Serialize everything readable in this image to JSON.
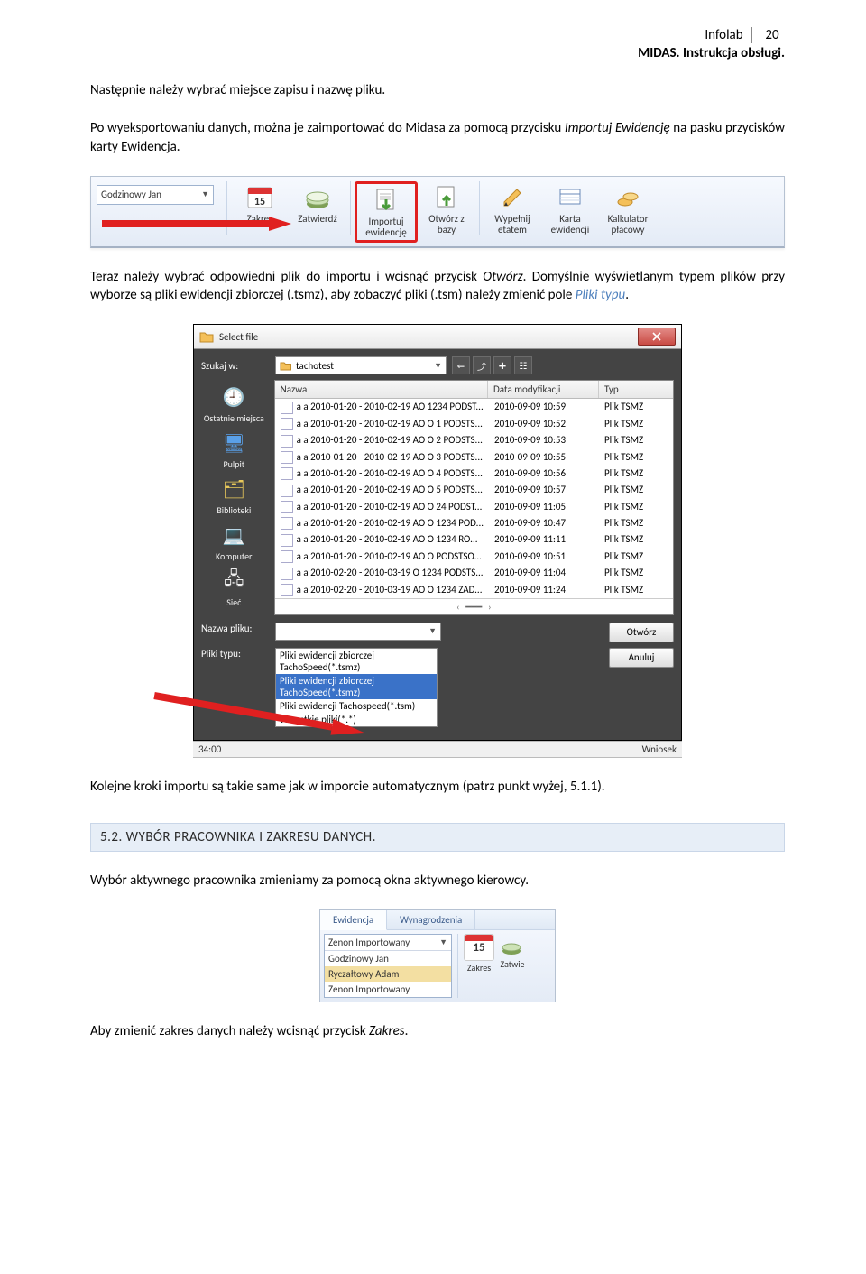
{
  "header": {
    "label": "Infolab",
    "page": "20",
    "doc_title": "MIDAS. Instrukcja obsługi."
  },
  "para1": "Następnie należy wybrać miejsce zapisu i nazwę pliku.",
  "para2_a": "Po wyeksportowaniu danych, można je zaimportować do Midasa za pomocą przycisku ",
  "para2_b": "Importuj Ewidencję",
  "para2_c": " na pasku przycisków karty Ewidencja.",
  "toolbar": {
    "driver": "Godzinowy Jan",
    "buttons": {
      "zakres": "Zakres",
      "zatwierdz": "Zatwierdź",
      "importuj_l1": "Importuj",
      "importuj_l2": "ewidencję",
      "otworz_l1": "Otwórz z",
      "otworz_l2": "bazy",
      "wypelnij_l1": "Wypełnij",
      "wypelnij_l2": "etatem",
      "karta_l1": "Karta",
      "karta_l2": "ewidencji",
      "kalk_l1": "Kalkulator",
      "kalk_l2": "płacowy"
    }
  },
  "para3_a": "Teraz należy wybrać odpowiedni plik do importu i wcisnąć przycisk ",
  "para3_b": "Otwórz",
  "para3_c": ". Domyślnie wyświetlanym typem plików przy wyborze są pliki ewidencji zbiorczej (.tsmz), aby zobaczyć pliki (.tsm) należy zmienić pole ",
  "para3_d": "Pliki typu",
  "para3_e": ".",
  "dialog": {
    "title": "Select file",
    "szukaj_label": "Szukaj w:",
    "szukaj_value": "tachotest",
    "cols": {
      "name": "Nazwa",
      "date": "Data modyfikacji",
      "type": "Typ"
    },
    "sidebar": {
      "recent": "Ostatnie miejsca",
      "desktop": "Pulpit",
      "libs": "Biblioteki",
      "computer": "Komputer",
      "network": "Sieć"
    },
    "rows": [
      {
        "n": "a a 2010-01-20 - 2010-02-19 AO 1234 PODST...",
        "d": "2010-09-09 10:59",
        "t": "Plik TSMZ"
      },
      {
        "n": "a a 2010-01-20 - 2010-02-19 AO O 1 PODSTS...",
        "d": "2010-09-09 10:52",
        "t": "Plik TSMZ"
      },
      {
        "n": "a a 2010-01-20 - 2010-02-19 AO O 2 PODSTS...",
        "d": "2010-09-09 10:53",
        "t": "Plik TSMZ"
      },
      {
        "n": "a a 2010-01-20 - 2010-02-19 AO O 3 PODSTS...",
        "d": "2010-09-09 10:55",
        "t": "Plik TSMZ"
      },
      {
        "n": "a a 2010-01-20 - 2010-02-19 AO O 4 PODSTS...",
        "d": "2010-09-09 10:56",
        "t": "Plik TSMZ"
      },
      {
        "n": "a a 2010-01-20 - 2010-02-19 AO O 5 PODSTS...",
        "d": "2010-09-09 10:57",
        "t": "Plik TSMZ"
      },
      {
        "n": "a a 2010-01-20 - 2010-02-19 AO O 24 PODST...",
        "d": "2010-09-09 11:05",
        "t": "Plik TSMZ"
      },
      {
        "n": "a a 2010-01-20 - 2010-02-19 AO O 1234 POD...",
        "d": "2010-09-09 10:47",
        "t": "Plik TSMZ"
      },
      {
        "n": "a a 2010-01-20 - 2010-02-19 AO O 1234 RO...",
        "d": "2010-09-09 11:11",
        "t": "Plik TSMZ"
      },
      {
        "n": "a a 2010-01-20 - 2010-02-19 AO O PODSTSO...",
        "d": "2010-09-09 10:51",
        "t": "Plik TSMZ"
      },
      {
        "n": "a a 2010-02-20 - 2010-03-19 O 1234 PODSTS...",
        "d": "2010-09-09 11:04",
        "t": "Plik TSMZ"
      },
      {
        "n": "a a 2010-02-20 - 2010-03-19 AO O 1234 ZAD...",
        "d": "2010-09-09 11:24",
        "t": "Plik TSMZ"
      }
    ],
    "filename_label": "Nazwa pliku:",
    "filename_value": "",
    "type_label": "Pliki typu:",
    "type_options": {
      "o1": "Pliki ewidencji zbiorczej TachoSpeed(*.tsmz)",
      "o2": "Pliki ewidencji zbiorczej TachoSpeed(*.tsmz)",
      "o3": "Pliki ewidencji Tachospeed(*.tsm)",
      "o4": "Wszystkie pliki(*.*)"
    },
    "open_btn": "Otwórz",
    "cancel_btn": "Anuluj",
    "strip_left": "34:00",
    "strip_right": "Wniosek"
  },
  "para4": "Kolejne kroki importu są takie same jak w imporcie automatycznym (patrz punkt wyżej, 5.1.1).",
  "section_heading": "5.2. WYBÓR PRACOWNIKA I ZAKRESU DANYCH.",
  "para5": "Wybór aktywnego pracownika zmieniamy za pomocą okna aktywnego kierowcy.",
  "mini": {
    "tab1": "Ewidencja",
    "tab2": "Wynagrodzenia",
    "selected": "Zenon Importowany",
    "opt1": "Godzinowy Jan",
    "opt2": "Ryczałtowy Adam",
    "opt3": "Zenon Importowany",
    "day": "15",
    "zakres": "Zakres",
    "zatw": "Zatwie"
  },
  "para6_a": "Aby zmienić zakres danych należy wcisnąć przycisk ",
  "para6_b": "Zakres",
  "para6_c": "."
}
